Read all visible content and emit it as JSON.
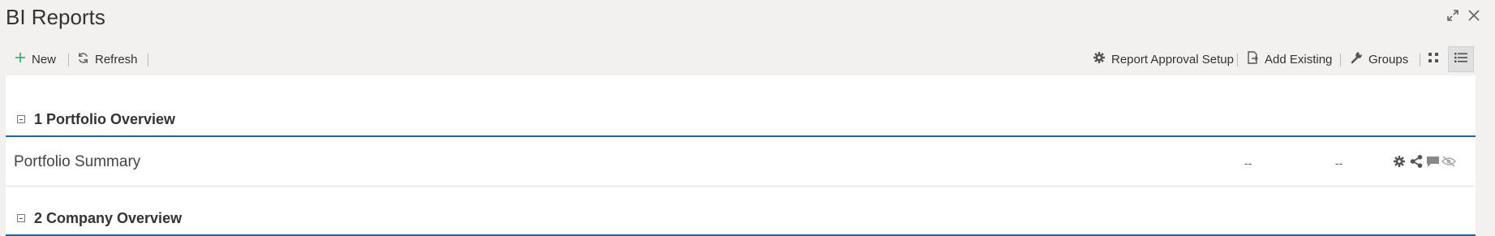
{
  "window": {
    "title": "BI Reports",
    "controls": [
      {
        "name": "expand-icon",
        "icon": "expand"
      },
      {
        "name": "close-icon",
        "icon": "close"
      }
    ]
  },
  "toolbar": {
    "new_label": "New",
    "refresh_label": "Refresh",
    "report_approval_label": "Report Approval Setup",
    "add_existing_label": "Add Existing",
    "groups_label": "Groups",
    "views": [
      {
        "name": "tile-view",
        "active": false
      },
      {
        "name": "list-view",
        "active": true
      }
    ]
  },
  "groups": [
    {
      "label": "1 Portfolio Overview",
      "expanded": true,
      "reports": [
        {
          "name": "Portfolio Summary",
          "col1": "--",
          "col2": "--",
          "actions": [
            "gear-icon",
            "share-icon",
            "comment-icon",
            "eye-slash-icon"
          ]
        }
      ]
    },
    {
      "label": "2 Company Overview",
      "expanded": true,
      "reports": []
    }
  ],
  "colors": {
    "accent_green": "#3cb371",
    "header_rule": "#1f63a8",
    "icon_gray": "#555555",
    "icon_light": "#999999"
  }
}
